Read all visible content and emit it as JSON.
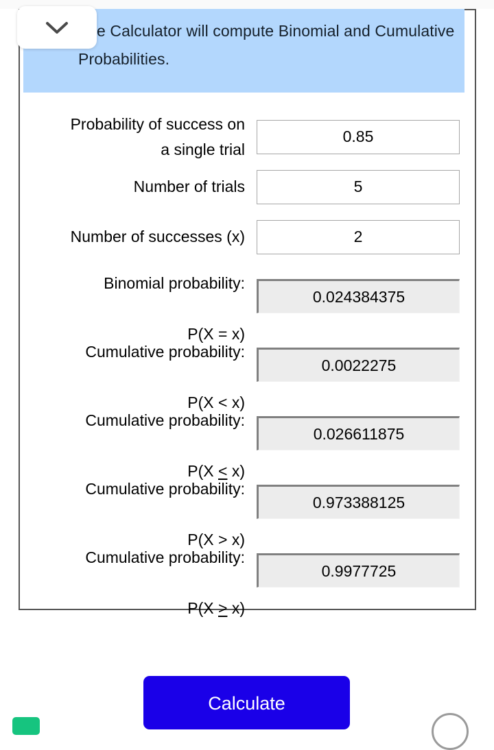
{
  "banner": {
    "text": "The Calculator will compute Binomial and Cumulative Probabilities.",
    "background_color": "#b3d7fd",
    "collapse_icon": "chevron-down-icon"
  },
  "inputs": [
    {
      "label": "Probability of success on\na single trial",
      "value": "0.85",
      "name": "probability-of-success"
    },
    {
      "label": "Number of trials",
      "value": "5",
      "name": "number-of-trials"
    },
    {
      "label": "Number of successes (x)",
      "value": "2",
      "name": "number-of-successes"
    }
  ],
  "outputs": [
    {
      "label_line1": "Binomial probability:",
      "label_prefix": "P(X ",
      "label_operator": "=",
      "label_suffix": " x)",
      "operator_underlined": false,
      "value": "0.024384375",
      "name": "binomial-probability-equal"
    },
    {
      "label_line1": "Cumulative probability:",
      "label_prefix": "P(X ",
      "label_operator": "<",
      "label_suffix": " x)",
      "operator_underlined": false,
      "value": "0.0022275",
      "name": "cumulative-probability-less-than"
    },
    {
      "label_line1": "Cumulative probability:",
      "label_prefix": "P(X ",
      "label_operator": "<",
      "label_suffix": " x)",
      "operator_underlined": true,
      "value": "0.026611875",
      "name": "cumulative-probability-less-than-or-equal"
    },
    {
      "label_line1": "Cumulative probability:",
      "label_prefix": "P(X ",
      "label_operator": ">",
      "label_suffix": " x)",
      "operator_underlined": false,
      "value": "0.973388125",
      "name": "cumulative-probability-greater-than"
    },
    {
      "label_line1": "Cumulative probability:",
      "label_prefix": "P(X ",
      "label_operator": ">",
      "label_suffix": " x)",
      "operator_underlined": true,
      "value": "0.9977725",
      "name": "cumulative-probability-greater-than-or-equal"
    }
  ],
  "actions": {
    "calculate_label": "Calculate",
    "calculate_color": "#1a00e8"
  },
  "bottom_chrome": {
    "left_icon": "green-keyboard-icon",
    "right_icon": "circle-outline-icon",
    "left_icon_color": "#16c47f",
    "right_icon_color": "#9a9a9a"
  }
}
